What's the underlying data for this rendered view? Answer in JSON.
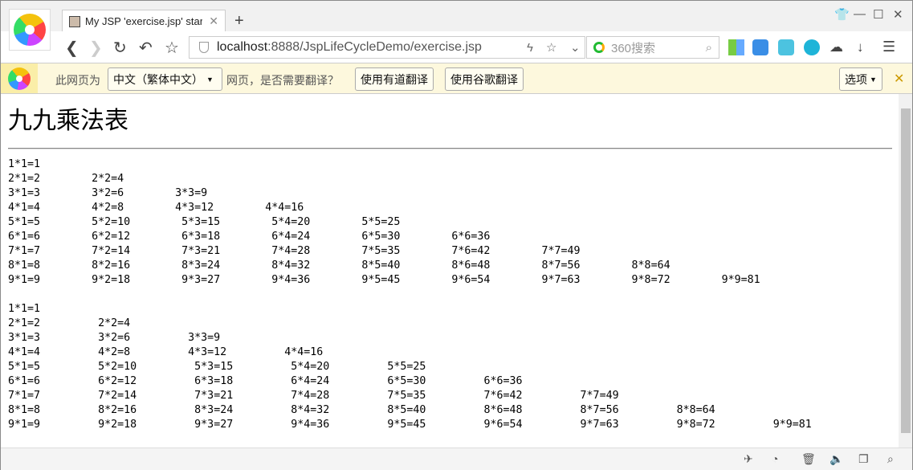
{
  "browser": {
    "tab_title": "My JSP 'exercise.jsp' starti",
    "url_host": "localhost",
    "url_path": ":8888/JspLifeCycleDemo/exercise.jsp",
    "search_placeholder": "360搜索"
  },
  "translate_bar": {
    "prefix": "此网页为",
    "language": "中文（繁体中文）",
    "question": "网页，是否需要翻译？",
    "youdao_button": "使用有道翻译",
    "google_button": "使用谷歌翻译",
    "options_button": "选项"
  },
  "page": {
    "heading": "九九乘法表",
    "tables": [
      [
        "1*1=1",
        "2*1=2|2*2=4",
        "3*1=3|3*2=6|3*3=9",
        "4*1=4|4*2=8|4*3=12|4*4=16",
        "5*1=5|5*2=10|5*3=15|5*4=20|5*5=25",
        "6*1=6|6*2=12|6*3=18|6*4=24|6*5=30|6*6=36",
        "7*1=7|7*2=14|7*3=21|7*4=28|7*5=35|7*6=42|7*7=49",
        "8*1=8|8*2=16|8*3=24|8*4=32|8*5=40|8*6=48|8*7=56|8*8=64",
        "9*1=9|9*2=18|9*3=27|9*4=36|9*5=45|9*6=54|9*7=63|9*8=72|9*9=81"
      ],
      [
        "1*1=1",
        "2*1=2|2*2=4",
        "3*1=3|3*2=6|3*3=9",
        "4*1=4|4*2=8|4*3=12|4*4=16",
        "5*1=5|5*2=10|5*3=15|5*4=20|5*5=25",
        "6*1=6|6*2=12|6*3=18|6*4=24|6*5=30|6*6=36",
        "7*1=7|7*2=14|7*3=21|7*4=28|7*5=35|7*6=42|7*7=49",
        "8*1=8|8*2=16|8*3=24|8*4=32|8*5=40|8*6=48|8*7=56|8*8=64",
        "9*1=9|9*2=18|9*3=27|9*4=36|9*5=45|9*6=54|9*7=63|9*8=72|9*9=81"
      ]
    ]
  }
}
